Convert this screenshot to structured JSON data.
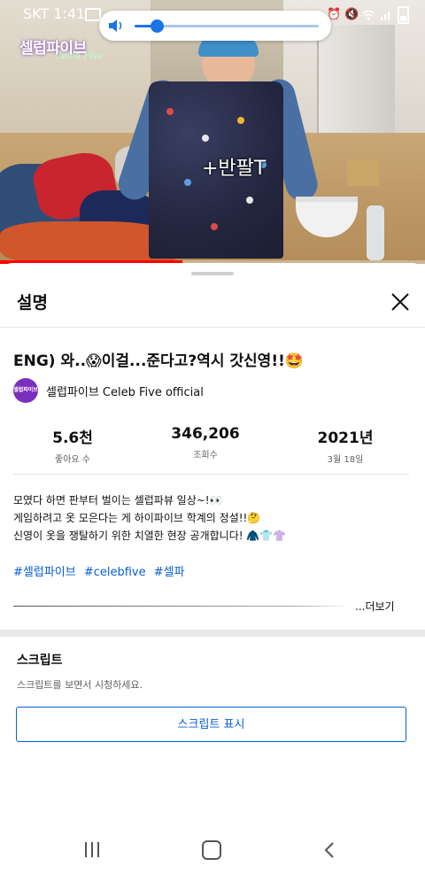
{
  "status_bar": {
    "carrier_time": "SKT 1:41"
  },
  "volume_popup": {
    "level": 0.12
  },
  "video": {
    "logo_text": "셀럽파이브",
    "logo_sub": "Celeb Five",
    "caption": "+반팔T",
    "progress": 0.43
  },
  "sheet": {
    "title": "설명",
    "video_title": "ENG) 와..😱이걸...준다고?역시 갓신영!!🤩",
    "channel": {
      "avatar_text": "셀럽파이브",
      "name": "셀럽파이브 Celeb Five official"
    },
    "stats": [
      {
        "value": "5.6천",
        "label": "좋아요 수"
      },
      {
        "value": "346,206",
        "label": "조회수"
      },
      {
        "value": "2021년",
        "label": "3월 18일"
      }
    ],
    "description": [
      "모였다 하면 판부터 벌이는 셀럽파뷰 일상~!👀",
      "게임하려고 옷 모은다는 게 하이파이브 학계의 정설!!🤔",
      "신영이 옷을 쟁탈하기 위한 치열한 현장 공개합니다! 🧥👕👚"
    ],
    "hashtags": [
      "#셀럽파이브",
      "#celebfive",
      "#셀파"
    ],
    "more_label": "...더보기"
  },
  "script_section": {
    "title": "스크립트",
    "description": "스크립트를 보면서 시청하세요.",
    "button_label": "스크립트 표시"
  },
  "colors": {
    "accent_blue": "#065fd4",
    "progress_red": "#ff0000",
    "volume_blue": "#1a73e8"
  }
}
